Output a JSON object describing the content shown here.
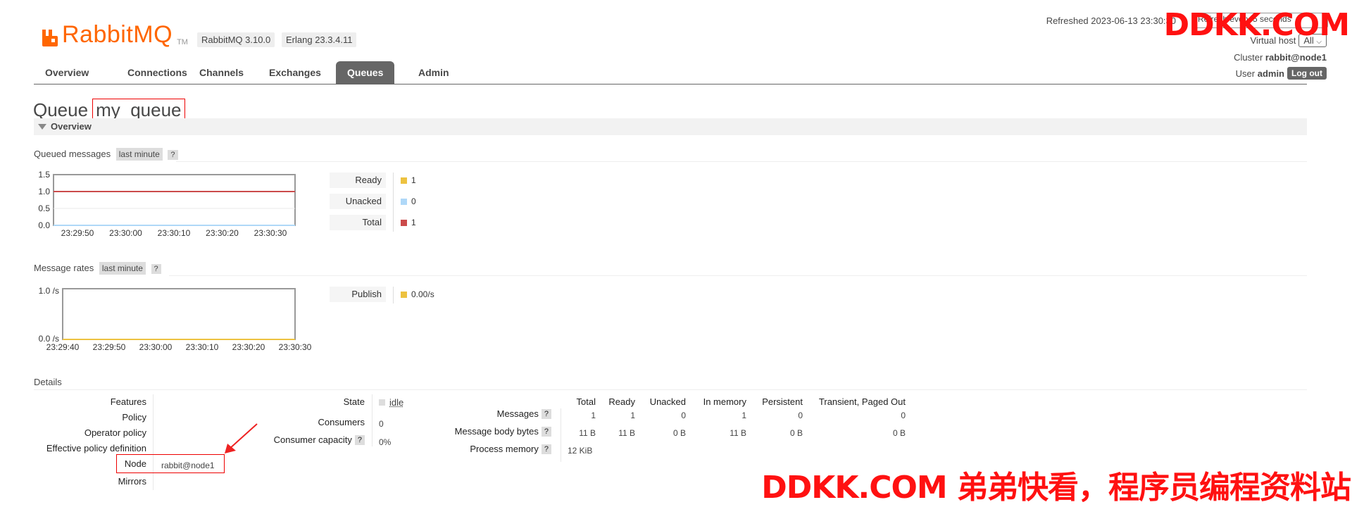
{
  "header": {
    "logo_text": "RabbitMQ",
    "logo_tm": "TM",
    "version": "RabbitMQ 3.10.0",
    "erlang": "Erlang 23.3.4.11",
    "refreshed": "Refreshed 2023-06-13 23:30:30",
    "refresh_select": "Refresh every 5 seconds",
    "virtual_host_label": "Virtual host",
    "virtual_host_value": "All",
    "cluster_label": "Cluster",
    "cluster_value": "rabbit@node1",
    "user_label": "User",
    "user_value": "admin",
    "logout": "Log out",
    "accent": "#ff6600"
  },
  "tabs": [
    "Overview",
    "Connections",
    "Channels",
    "Exchanges",
    "Queues",
    "Admin"
  ],
  "active_tab": "Queues",
  "page": {
    "title_prefix": "Queue",
    "queue_name": "my_queue",
    "section": "Overview"
  },
  "queued_messages": {
    "label": "Queued messages",
    "period": "last minute",
    "help": "?",
    "chart_data": {
      "type": "line",
      "x": [
        "23:29:50",
        "23:30:00",
        "23:30:10",
        "23:30:20",
        "23:30:30"
      ],
      "yticks": [
        "1.5",
        "1.0",
        "0.5",
        "0.0"
      ],
      "ylim": [
        0,
        1.5
      ],
      "series": [
        {
          "name": "Ready",
          "color": "#edc240",
          "values": [
            1,
            1,
            1,
            1,
            1
          ]
        },
        {
          "name": "Unacked",
          "color": "#afd8f8",
          "values": [
            0,
            0,
            0,
            0,
            0
          ]
        },
        {
          "name": "Total",
          "color": "#cb4b4b",
          "values": [
            1,
            1,
            1,
            1,
            1
          ]
        }
      ]
    },
    "legend": [
      {
        "label": "Ready",
        "value": "1",
        "color": "#edc240"
      },
      {
        "label": "Unacked",
        "value": "0",
        "color": "#afd8f8"
      },
      {
        "label": "Total",
        "value": "1",
        "color": "#cb4b4b"
      }
    ]
  },
  "message_rates": {
    "label": "Message rates",
    "period": "last minute",
    "help": "?",
    "chart_data": {
      "type": "line",
      "x": [
        "23:29:40",
        "23:29:50",
        "23:30:00",
        "23:30:10",
        "23:30:20",
        "23:30:30"
      ],
      "yticks": [
        "1.0 /s",
        "0.0 /s"
      ],
      "ylim": [
        0,
        1
      ],
      "series": [
        {
          "name": "Publish",
          "color": "#edc240",
          "values": [
            0,
            0,
            0,
            0,
            0,
            0
          ]
        }
      ]
    },
    "legend": [
      {
        "label": "Publish",
        "value": "0.00/s",
        "color": "#edc240"
      }
    ]
  },
  "details": {
    "label": "Details",
    "left_labels": [
      "Features",
      "Policy",
      "Operator policy",
      "Effective policy definition",
      "Node",
      "Mirrors"
    ],
    "node_value": "rabbit@node1",
    "state_label": "State",
    "state_value": "idle",
    "consumers_label": "Consumers",
    "consumers_value": "0",
    "consumer_capacity_label": "Consumer capacity",
    "consumer_capacity_value": "0%",
    "help": "?",
    "stats_headers": [
      "Total",
      "Ready",
      "Unacked",
      "In memory",
      "Persistent",
      "Transient, Paged Out"
    ],
    "stats_rows": [
      {
        "label": "Messages",
        "values": [
          "1",
          "1",
          "0",
          "1",
          "0",
          "0"
        ]
      },
      {
        "label": "Message body bytes",
        "values": [
          "11 B",
          "11 B",
          "0 B",
          "11 B",
          "0 B",
          "0 B"
        ]
      },
      {
        "label": "Process memory",
        "values": [
          "12 KiB"
        ]
      }
    ]
  },
  "watermark": {
    "top": "DDKK.COM",
    "bottom": "DDKK.COM 弟弟快看，程序员编程资料站"
  }
}
